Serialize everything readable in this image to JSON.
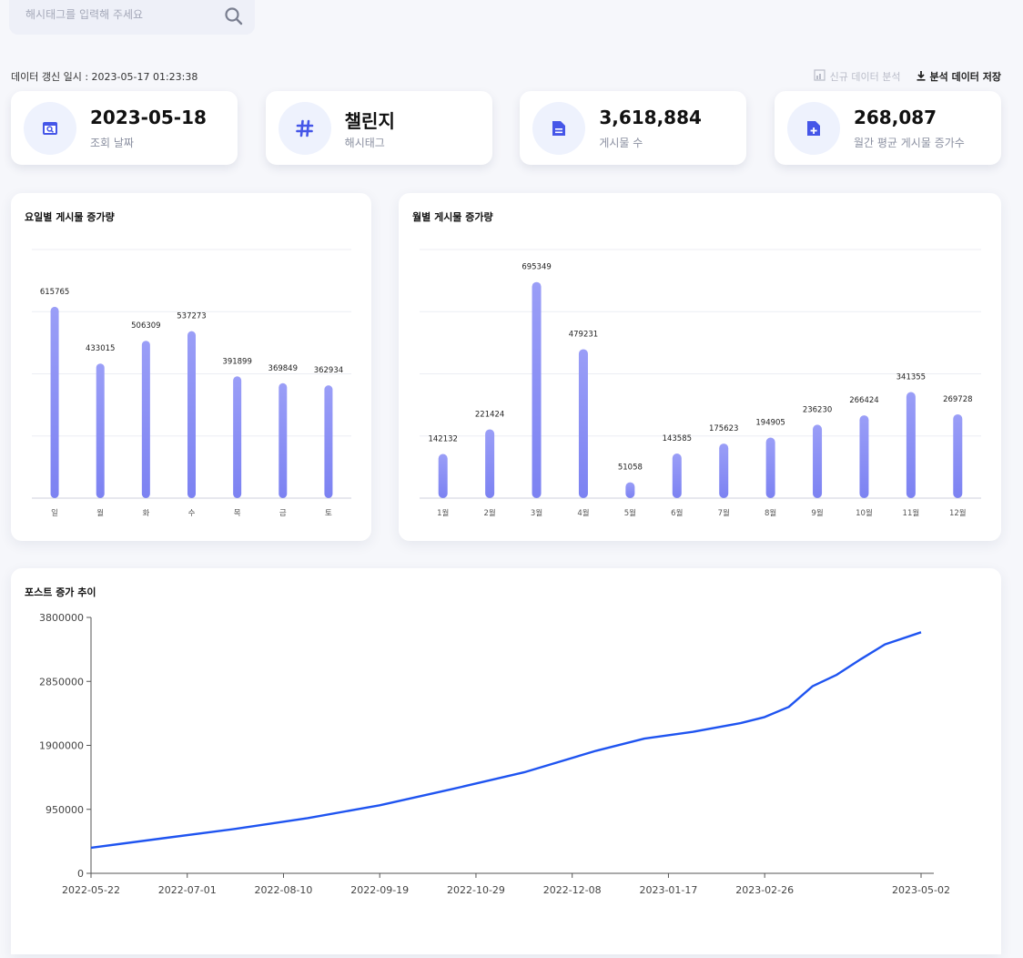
{
  "search": {
    "placeholder": "해시태그를 입력해 주세요",
    "icon": "search-icon"
  },
  "updated_text": "데이터 갱신 일시 : 2023-05-17 01:23:38",
  "actions": {
    "new_analysis": "신규 데이터 분석",
    "save": "분석 데이터 저장"
  },
  "colors": {
    "accent": "#4556e8",
    "bar": "#8b8ff5",
    "line": "#1f54f0",
    "icon_bg": "#eef2fd"
  },
  "cards": [
    {
      "value": "2023-05-18",
      "label": "조회 날짜",
      "icon": "calendar-search-icon"
    },
    {
      "value": "챌린지",
      "label": "해시태그",
      "icon": "hashtag-icon"
    },
    {
      "value": "3,618,884",
      "label": "게시물 수",
      "icon": "document-icon"
    },
    {
      "value": "268,087",
      "label": "월간 평균 게시물 증가수",
      "icon": "document-plus-icon"
    }
  ],
  "chart_data": [
    {
      "type": "bar",
      "title": "요일별 게시물 증가량",
      "categories": [
        "일",
        "월",
        "화",
        "수",
        "목",
        "금",
        "토"
      ],
      "values": [
        615765,
        433015,
        506309,
        537273,
        391899,
        369849,
        362934
      ],
      "ylim": [
        0,
        800000
      ],
      "grid": true
    },
    {
      "type": "bar",
      "title": "월별 게시물 증가량",
      "categories": [
        "1월",
        "2월",
        "3월",
        "4월",
        "5월",
        "6월",
        "7월",
        "8월",
        "9월",
        "10월",
        "11월",
        "12월"
      ],
      "values": [
        142132,
        221424,
        695349,
        479231,
        51058,
        143585,
        175623,
        194905,
        236230,
        266424,
        341355,
        269728
      ],
      "ylim": [
        0,
        800000
      ],
      "grid": true
    },
    {
      "type": "line",
      "title": "포스트 증가 추이",
      "xticks": [
        "2022-05-22",
        "2022-07-01",
        "2022-08-10",
        "2022-09-19",
        "2022-10-29",
        "2022-12-08",
        "2023-01-17",
        "2023-02-26",
        "2023-05-02"
      ],
      "yticks": [
        "0",
        "950000",
        "1900000",
        "2850000",
        "3800000"
      ],
      "ylim": [
        0,
        3800000
      ],
      "x": [
        "2022-05-22",
        "2022-06-21",
        "2022-07-21",
        "2022-08-20",
        "2022-09-19",
        "2022-10-19",
        "2022-11-18",
        "2022-12-18",
        "2023-01-07",
        "2023-01-27",
        "2023-02-16",
        "2023-02-26",
        "2023-03-08",
        "2023-03-18",
        "2023-03-28",
        "2023-04-07",
        "2023-04-17",
        "2023-05-02"
      ],
      "y": [
        380000,
        520000,
        660000,
        820000,
        1010000,
        1250000,
        1500000,
        1820000,
        2000000,
        2100000,
        2230000,
        2320000,
        2470000,
        2780000,
        2950000,
        3180000,
        3400000,
        3580000
      ]
    }
  ]
}
